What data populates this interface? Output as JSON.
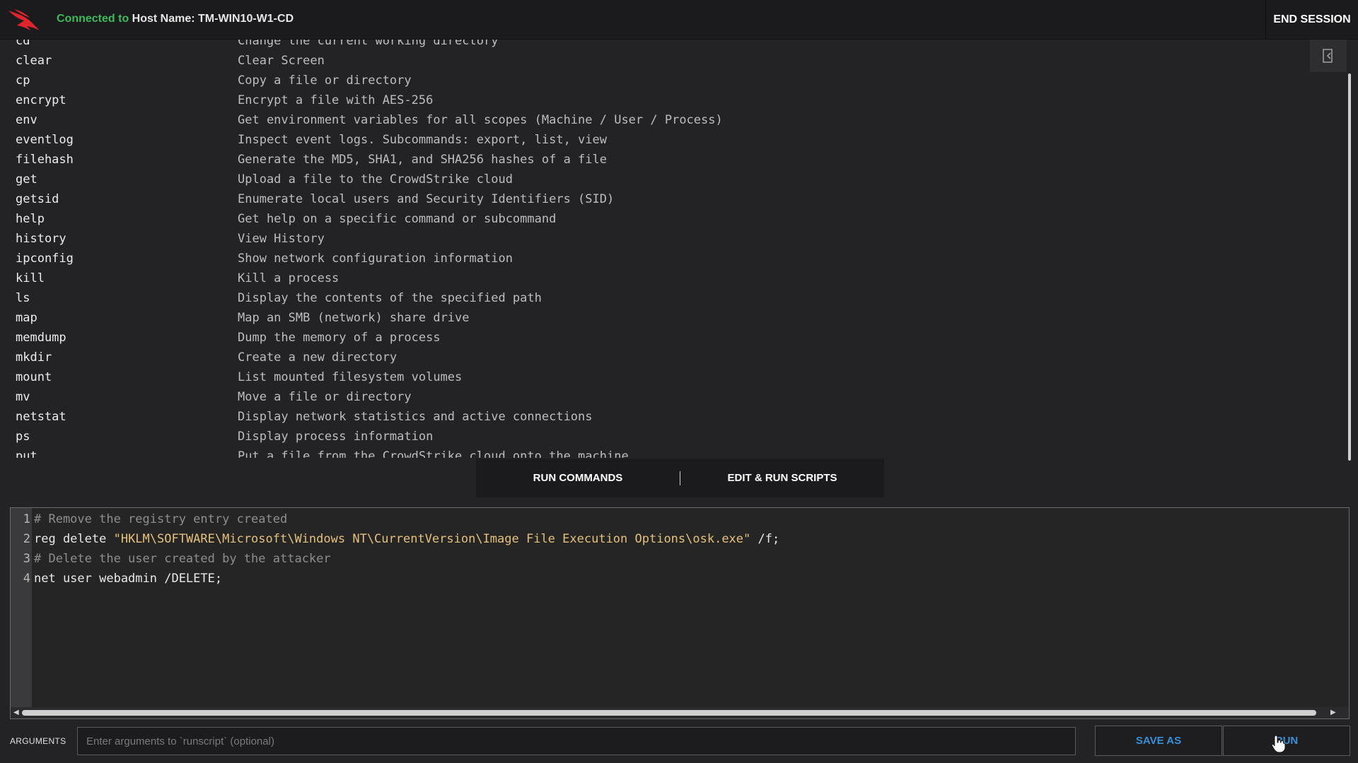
{
  "header": {
    "connected_label": "Connected to",
    "host_label": "Host Name: TM-WIN10-W1-CD",
    "end_session_label": "END SESSION",
    "accent_green": "#3dbb5a",
    "logo_icon": "falcon-logo-icon"
  },
  "output": {
    "rows": [
      {
        "cmd": "cd",
        "desc": "Change the current working directory"
      },
      {
        "cmd": "clear",
        "desc": "Clear Screen"
      },
      {
        "cmd": "cp",
        "desc": "Copy a file or directory"
      },
      {
        "cmd": "encrypt",
        "desc": "Encrypt a file with AES-256"
      },
      {
        "cmd": "env",
        "desc": "Get environment variables for all scopes (Machine / User / Process)"
      },
      {
        "cmd": "eventlog",
        "desc": "Inspect event logs. Subcommands: export, list, view"
      },
      {
        "cmd": "filehash",
        "desc": "Generate the MD5, SHA1, and SHA256 hashes of a file"
      },
      {
        "cmd": "get",
        "desc": "Upload a file to the CrowdStrike cloud"
      },
      {
        "cmd": "getsid",
        "desc": "Enumerate local users and Security Identifiers (SID)"
      },
      {
        "cmd": "help",
        "desc": "Get help on a specific command or subcommand"
      },
      {
        "cmd": "history",
        "desc": "View History"
      },
      {
        "cmd": "ipconfig",
        "desc": "Show network configuration information"
      },
      {
        "cmd": "kill",
        "desc": "Kill a process"
      },
      {
        "cmd": "ls",
        "desc": "Display the contents of the specified path"
      },
      {
        "cmd": "map",
        "desc": "Map an SMB (network) share drive"
      },
      {
        "cmd": "memdump",
        "desc": "Dump the memory of a process"
      },
      {
        "cmd": "mkdir",
        "desc": "Create a new directory"
      },
      {
        "cmd": "mount",
        "desc": "List mounted filesystem volumes"
      },
      {
        "cmd": "mv",
        "desc": "Move a file or directory"
      },
      {
        "cmd": "netstat",
        "desc": "Display network statistics and active connections"
      },
      {
        "cmd": "ps",
        "desc": "Display process information"
      },
      {
        "cmd": "put",
        "desc": "Put a file from the CrowdStrike cloud onto the machine"
      }
    ]
  },
  "tabs": [
    {
      "label": "RUN COMMANDS"
    },
    {
      "label": "EDIT & RUN SCRIPTS"
    }
  ],
  "editor": {
    "line_numbers": [
      "1",
      "2",
      "3",
      "4"
    ],
    "lines": [
      {
        "tokens": [
          {
            "type": "comment",
            "text": "# Remove the registry entry created"
          }
        ]
      },
      {
        "tokens": [
          {
            "type": "plain",
            "text": "reg delete "
          },
          {
            "type": "string",
            "text": "\"HKLM\\SOFTWARE\\Microsoft\\Windows NT\\CurrentVersion\\Image File Execution Options\\osk.exe\""
          },
          {
            "type": "plain",
            "text": " /f;"
          }
        ]
      },
      {
        "tokens": [
          {
            "type": "comment",
            "text": "# Delete the user created by the attacker"
          }
        ]
      },
      {
        "tokens": [
          {
            "type": "plain",
            "text": "net user webadmin /DELETE;"
          }
        ]
      }
    ]
  },
  "bottom": {
    "arguments_label": "ARGUMENTS",
    "arguments_placeholder": "Enter arguments to `runscript` (optional)",
    "arguments_value": "",
    "save_as_label": "SAVE AS",
    "run_label": "RUN",
    "button_text_color": "#3a8fd6"
  }
}
